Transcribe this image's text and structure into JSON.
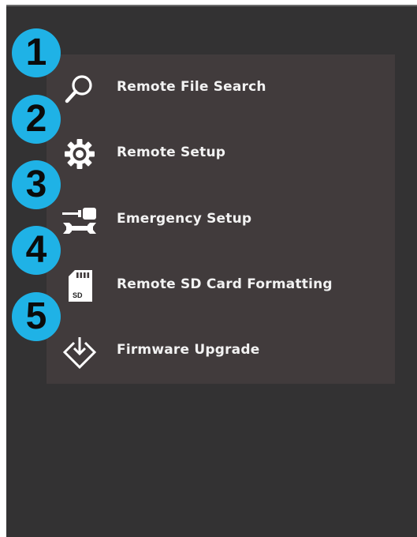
{
  "menu": {
    "items": [
      {
        "label": "Remote File Search",
        "icon": "search-icon",
        "badge": "1"
      },
      {
        "label": "Remote Setup",
        "icon": "gear-icon",
        "badge": "2"
      },
      {
        "label": "Emergency Setup",
        "icon": "tools-icon",
        "badge": "3"
      },
      {
        "label": "Remote SD Card Formatting",
        "icon": "sd-card-icon",
        "badge": "4"
      },
      {
        "label": "Firmware Upgrade",
        "icon": "download-icon",
        "badge": "5"
      }
    ]
  },
  "colors": {
    "background": "#333233",
    "panel": "#413b3c",
    "badge": "#1fb2e6",
    "text": "#f2f2f2"
  }
}
